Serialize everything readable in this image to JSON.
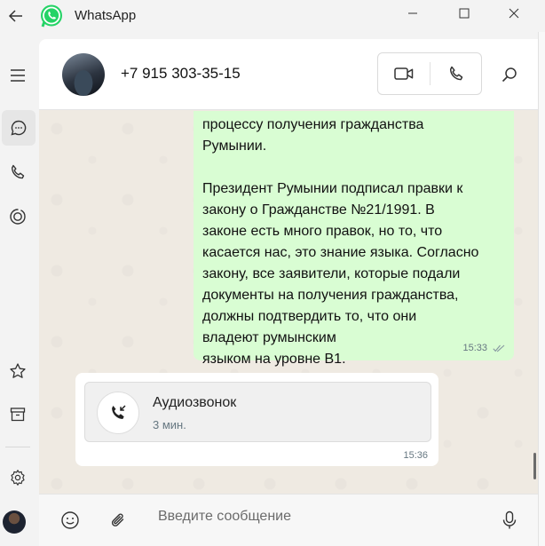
{
  "app": {
    "title": "WhatsApp"
  },
  "contact": {
    "name": "+7 915 303-35-15"
  },
  "messages": {
    "outgoing": {
      "text": "процессу получения гражданства\nРумынии.\n\nПрезидент Румынии подписал правки к\nзакону о Гражданстве №21/1991. В\nзаконе есть много правок, но то, что\nкасается нас, это знание языка. Согласно\nзакону, все заявители, которые подали\nдокументы на получения гражданства,\nдолжны подтвердить то, что они\nвладеют румынским\nязыком на уровне B1.",
      "time": "15:33",
      "status_icon": "double-check-icon"
    },
    "call": {
      "title": "Аудиозвонок",
      "duration": "3 мин.",
      "time": "15:36",
      "icon": "incoming-call-icon"
    }
  },
  "composer": {
    "placeholder": "Введите сообщение"
  },
  "colors": {
    "brand": "#25d366",
    "outgoing_bubble": "#d9fdd3",
    "chat_background": "#efeae2"
  }
}
